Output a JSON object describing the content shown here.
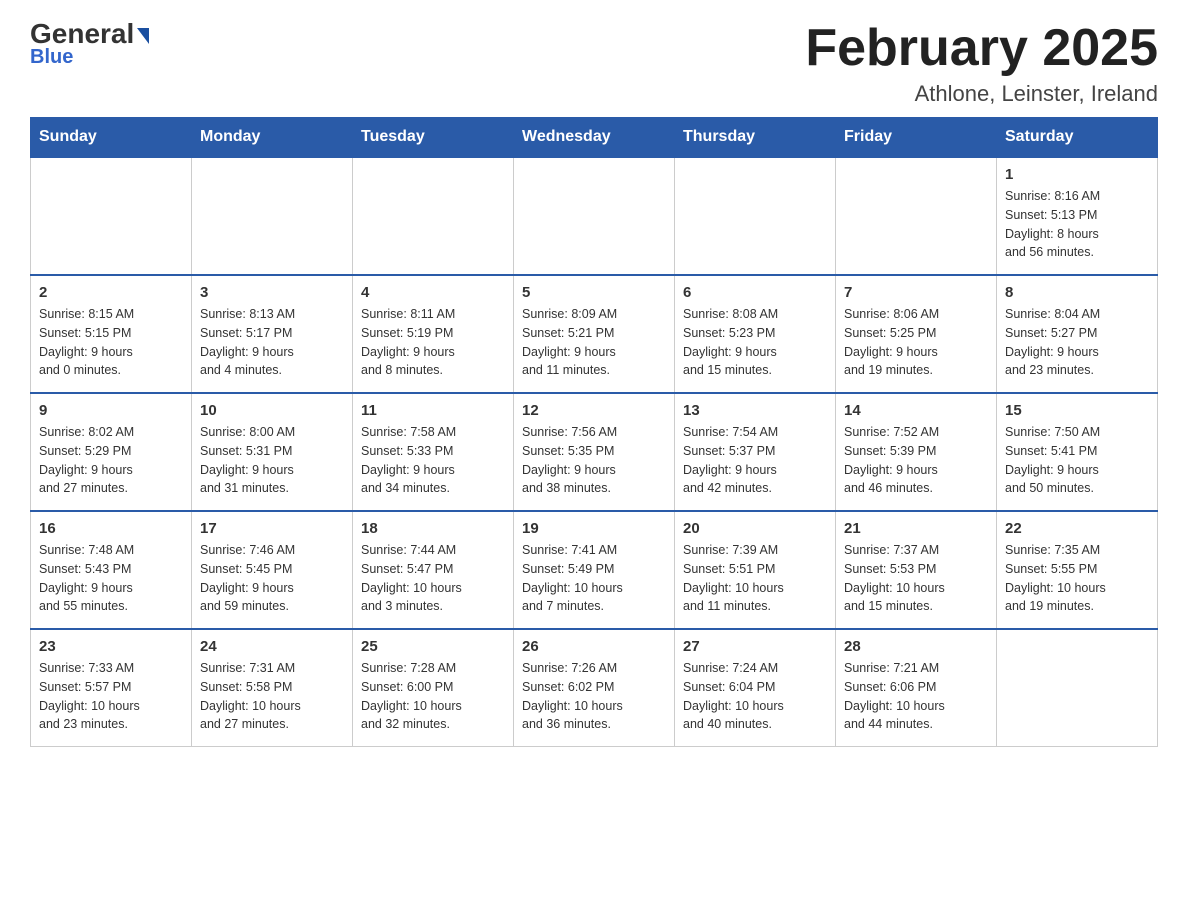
{
  "header": {
    "logo_general": "General",
    "logo_blue": "Blue",
    "title": "February 2025",
    "subtitle": "Athlone, Leinster, Ireland"
  },
  "weekdays": [
    "Sunday",
    "Monday",
    "Tuesday",
    "Wednesday",
    "Thursday",
    "Friday",
    "Saturday"
  ],
  "weeks": [
    [
      {
        "day": "",
        "info": ""
      },
      {
        "day": "",
        "info": ""
      },
      {
        "day": "",
        "info": ""
      },
      {
        "day": "",
        "info": ""
      },
      {
        "day": "",
        "info": ""
      },
      {
        "day": "",
        "info": ""
      },
      {
        "day": "1",
        "info": "Sunrise: 8:16 AM\nSunset: 5:13 PM\nDaylight: 8 hours\nand 56 minutes."
      }
    ],
    [
      {
        "day": "2",
        "info": "Sunrise: 8:15 AM\nSunset: 5:15 PM\nDaylight: 9 hours\nand 0 minutes."
      },
      {
        "day": "3",
        "info": "Sunrise: 8:13 AM\nSunset: 5:17 PM\nDaylight: 9 hours\nand 4 minutes."
      },
      {
        "day": "4",
        "info": "Sunrise: 8:11 AM\nSunset: 5:19 PM\nDaylight: 9 hours\nand 8 minutes."
      },
      {
        "day": "5",
        "info": "Sunrise: 8:09 AM\nSunset: 5:21 PM\nDaylight: 9 hours\nand 11 minutes."
      },
      {
        "day": "6",
        "info": "Sunrise: 8:08 AM\nSunset: 5:23 PM\nDaylight: 9 hours\nand 15 minutes."
      },
      {
        "day": "7",
        "info": "Sunrise: 8:06 AM\nSunset: 5:25 PM\nDaylight: 9 hours\nand 19 minutes."
      },
      {
        "day": "8",
        "info": "Sunrise: 8:04 AM\nSunset: 5:27 PM\nDaylight: 9 hours\nand 23 minutes."
      }
    ],
    [
      {
        "day": "9",
        "info": "Sunrise: 8:02 AM\nSunset: 5:29 PM\nDaylight: 9 hours\nand 27 minutes."
      },
      {
        "day": "10",
        "info": "Sunrise: 8:00 AM\nSunset: 5:31 PM\nDaylight: 9 hours\nand 31 minutes."
      },
      {
        "day": "11",
        "info": "Sunrise: 7:58 AM\nSunset: 5:33 PM\nDaylight: 9 hours\nand 34 minutes."
      },
      {
        "day": "12",
        "info": "Sunrise: 7:56 AM\nSunset: 5:35 PM\nDaylight: 9 hours\nand 38 minutes."
      },
      {
        "day": "13",
        "info": "Sunrise: 7:54 AM\nSunset: 5:37 PM\nDaylight: 9 hours\nand 42 minutes."
      },
      {
        "day": "14",
        "info": "Sunrise: 7:52 AM\nSunset: 5:39 PM\nDaylight: 9 hours\nand 46 minutes."
      },
      {
        "day": "15",
        "info": "Sunrise: 7:50 AM\nSunset: 5:41 PM\nDaylight: 9 hours\nand 50 minutes."
      }
    ],
    [
      {
        "day": "16",
        "info": "Sunrise: 7:48 AM\nSunset: 5:43 PM\nDaylight: 9 hours\nand 55 minutes."
      },
      {
        "day": "17",
        "info": "Sunrise: 7:46 AM\nSunset: 5:45 PM\nDaylight: 9 hours\nand 59 minutes."
      },
      {
        "day": "18",
        "info": "Sunrise: 7:44 AM\nSunset: 5:47 PM\nDaylight: 10 hours\nand 3 minutes."
      },
      {
        "day": "19",
        "info": "Sunrise: 7:41 AM\nSunset: 5:49 PM\nDaylight: 10 hours\nand 7 minutes."
      },
      {
        "day": "20",
        "info": "Sunrise: 7:39 AM\nSunset: 5:51 PM\nDaylight: 10 hours\nand 11 minutes."
      },
      {
        "day": "21",
        "info": "Sunrise: 7:37 AM\nSunset: 5:53 PM\nDaylight: 10 hours\nand 15 minutes."
      },
      {
        "day": "22",
        "info": "Sunrise: 7:35 AM\nSunset: 5:55 PM\nDaylight: 10 hours\nand 19 minutes."
      }
    ],
    [
      {
        "day": "23",
        "info": "Sunrise: 7:33 AM\nSunset: 5:57 PM\nDaylight: 10 hours\nand 23 minutes."
      },
      {
        "day": "24",
        "info": "Sunrise: 7:31 AM\nSunset: 5:58 PM\nDaylight: 10 hours\nand 27 minutes."
      },
      {
        "day": "25",
        "info": "Sunrise: 7:28 AM\nSunset: 6:00 PM\nDaylight: 10 hours\nand 32 minutes."
      },
      {
        "day": "26",
        "info": "Sunrise: 7:26 AM\nSunset: 6:02 PM\nDaylight: 10 hours\nand 36 minutes."
      },
      {
        "day": "27",
        "info": "Sunrise: 7:24 AM\nSunset: 6:04 PM\nDaylight: 10 hours\nand 40 minutes."
      },
      {
        "day": "28",
        "info": "Sunrise: 7:21 AM\nSunset: 6:06 PM\nDaylight: 10 hours\nand 44 minutes."
      },
      {
        "day": "",
        "info": ""
      }
    ]
  ]
}
